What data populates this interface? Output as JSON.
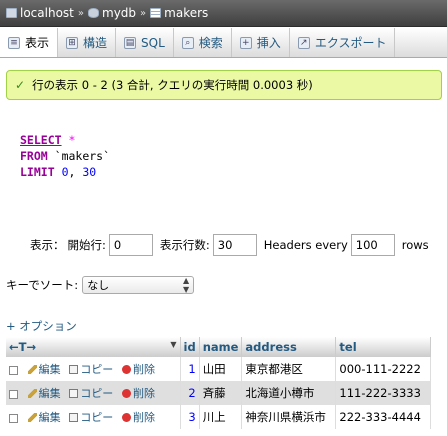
{
  "breadcrumb": {
    "server": "localhost",
    "database": "mydb",
    "table": "makers",
    "separator": "»"
  },
  "tabs": [
    {
      "label": "表示",
      "icon": "browse-icon",
      "active": true
    },
    {
      "label": "構造",
      "icon": "structure-icon"
    },
    {
      "label": "SQL",
      "icon": "sql-icon"
    },
    {
      "label": "検索",
      "icon": "search-icon"
    },
    {
      "label": "挿入",
      "icon": "insert-icon"
    },
    {
      "label": "エクスポート",
      "icon": "export-icon"
    }
  ],
  "message": {
    "check": "✓",
    "text": "行の表示 0 - 2 (3 合計, クエリの実行時間 0.0003 秒)"
  },
  "sql": {
    "select": "SELECT",
    "star": "*",
    "from": "FROM",
    "table": "`makers`",
    "limit": "LIMIT",
    "offset": "0",
    "comma": ",",
    "count": "30"
  },
  "navigation": {
    "show_label": "表示：",
    "start_label": "開始行:",
    "start_value": "0",
    "rows_label": "表示行数:",
    "rows_value": "30",
    "headers_label": "Headers every",
    "headers_value": "100",
    "rows_suffix": "rows"
  },
  "sort": {
    "label": "キーでソート:",
    "selected": "なし"
  },
  "options_link": "+ オプション",
  "table": {
    "nav_arrows": "←T→",
    "columns": [
      "id",
      "name",
      "address",
      "tel"
    ],
    "row_actions": {
      "edit": "編集",
      "copy": "コピー",
      "delete": "削除"
    },
    "rows": [
      {
        "id": "1",
        "name": "山田",
        "address": "東京都港区",
        "tel": "000-111-2222"
      },
      {
        "id": "2",
        "name": "斉藤",
        "address": "北海道小樽市",
        "tel": "111-222-3333"
      },
      {
        "id": "3",
        "name": "川上",
        "address": "神奈川県横浜市",
        "tel": "222-333-4444"
      }
    ]
  }
}
